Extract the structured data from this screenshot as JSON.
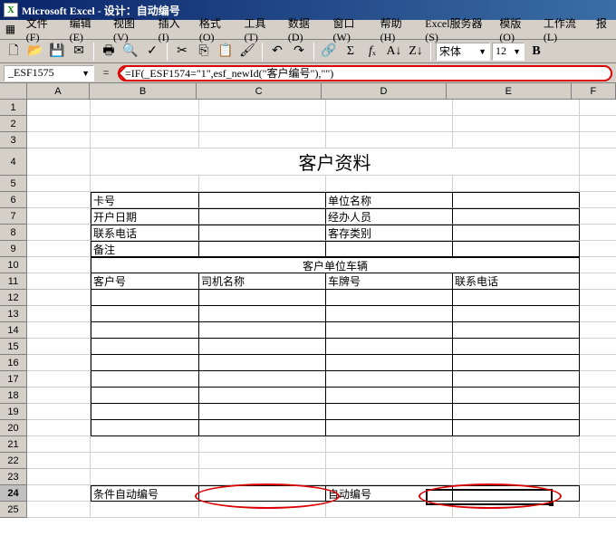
{
  "title": "Microsoft Excel - 设计：自动编号",
  "menu": [
    "文件(F)",
    "编辑(E)",
    "视图(V)",
    "插入(I)",
    "格式(O)",
    "工具(T)",
    "数据(D)",
    "窗口(W)",
    "帮助(H)"
  ],
  "menu_right": [
    "Excel服务器(S)",
    "模版(O)",
    "工作流(L)",
    "报"
  ],
  "font": {
    "name": "宋体",
    "size": "12"
  },
  "namebox": "_ESF1575",
  "formula": "=IF(_ESF1574=\"1\",esf_newId(\"客户编号\"),\"\")",
  "columns": [
    "A",
    "B",
    "C",
    "D",
    "E",
    "F"
  ],
  "rows": [
    "1",
    "2",
    "3",
    "4",
    "5",
    "6",
    "7",
    "8",
    "9",
    "10",
    "11",
    "12",
    "13",
    "14",
    "15",
    "16",
    "17",
    "18",
    "19",
    "20",
    "21",
    "22",
    "23",
    "24",
    "25"
  ],
  "selected_row": "24",
  "content": {
    "title": "客户资料",
    "r6b": "卡号",
    "r6d": "单位名称",
    "r7b": "开户日期",
    "r7d": "经办人员",
    "r8b": "联系电话",
    "r8d": "客存类别",
    "r9b": "备注",
    "r10": "客户单位车辆",
    "r11b": "客户号",
    "r11c": "司机名称",
    "r11d": "车牌号",
    "r11e": "联系电话",
    "r24b": "条件自动编号",
    "r24d": "自动编号"
  }
}
